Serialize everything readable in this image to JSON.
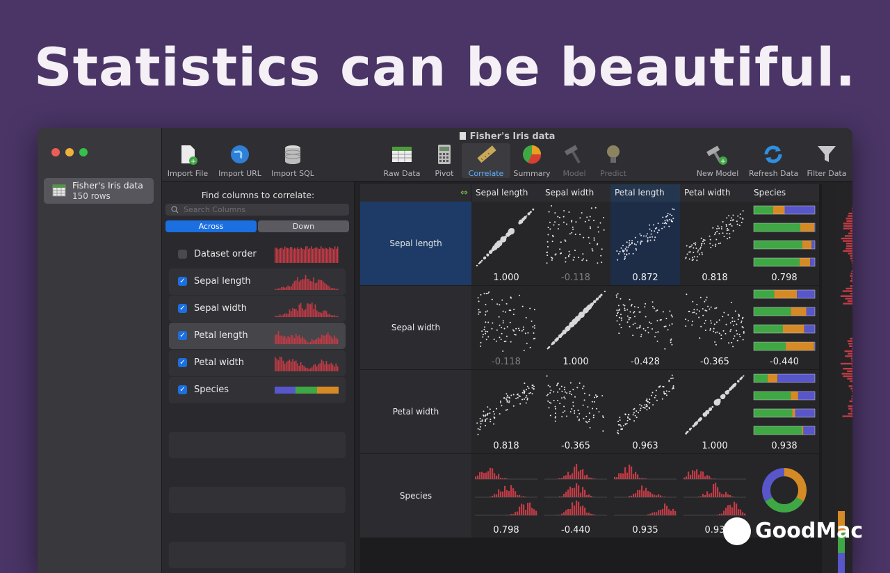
{
  "headline": "Statistics can be beautiful.",
  "window": {
    "title": "Fisher's Iris data"
  },
  "sidebar": {
    "dataset": {
      "name": "Fisher's Iris data",
      "rows": "150 rows"
    }
  },
  "toolbar": {
    "import_file": "Import File",
    "import_url": "Import URL",
    "import_sql": "Import SQL",
    "raw_data": "Raw Data",
    "pivot": "Pivot",
    "correlate": "Correlate",
    "summary": "Summary",
    "model": "Model",
    "predict": "Predict",
    "new_model": "New Model",
    "refresh_data": "Refresh Data",
    "filter_data": "Filter Data"
  },
  "left_panel": {
    "find_label": "Find columns to correlate:",
    "search_placeholder": "Search Columns",
    "segment_across": "Across",
    "segment_down": "Down",
    "columns": [
      {
        "name": "Dataset order",
        "checked": false
      },
      {
        "name": "Sepal length",
        "checked": true
      },
      {
        "name": "Sepal width",
        "checked": true
      },
      {
        "name": "Petal length",
        "checked": true
      },
      {
        "name": "Petal width",
        "checked": true
      },
      {
        "name": "Species",
        "checked": true
      }
    ],
    "check_mark": "✓"
  },
  "matrix": {
    "col_headers": [
      "Sepal length",
      "Sepal width",
      "Petal length",
      "Petal width",
      "Species"
    ],
    "row_labels": [
      "Sepal length",
      "Sepal width",
      "Petal width",
      "Species"
    ],
    "values": [
      [
        "1.000",
        "-0.118",
        "0.872",
        "0.818",
        "0.798"
      ],
      [
        "-0.118",
        "1.000",
        "-0.428",
        "-0.365",
        "-0.440"
      ],
      [
        "0.818",
        "-0.365",
        "0.963",
        "1.000",
        "0.938"
      ],
      [
        "0.798",
        "-0.440",
        "0.935",
        "0.93",
        ""
      ]
    ]
  },
  "colors": {
    "accent": "#1b6fe0",
    "bar_red": "#c23b45",
    "species_blue": "#5856c9",
    "species_green": "#3fa845",
    "species_orange": "#d68a26"
  },
  "watermark": "GoodMac"
}
